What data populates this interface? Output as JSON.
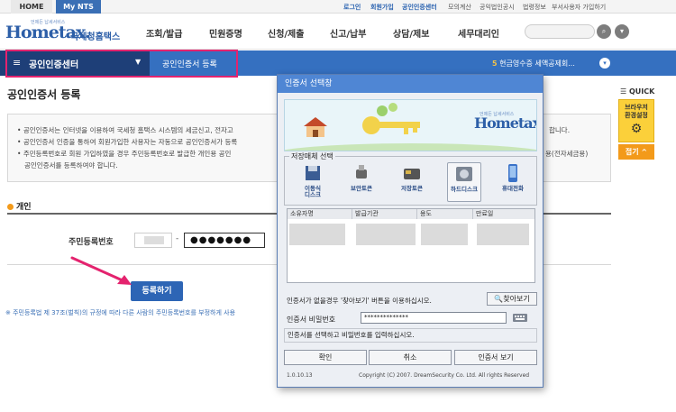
{
  "topbar": {
    "tab_home": "HOME",
    "tab_mynts": "My NTS",
    "links": [
      "로그인",
      "회원가입",
      "공인인증센터",
      "모의계산",
      "공익법인공시",
      "법령정보",
      "부서사용자 가입하기"
    ]
  },
  "header": {
    "logo_main": "Hometax.",
    "logo_sub": "국세청홈택스",
    "logo_tag": "언제든 납세서비스",
    "nav": [
      "조회/발급",
      "민원증명",
      "신청/제출",
      "신고/납부",
      "상담/제보",
      "세무대리인"
    ],
    "search_icon": "search-icon",
    "menu_icon": "chevron-down-icon"
  },
  "subnav": {
    "title": "공인인증센터",
    "breadcrumb": "공인인증서 등록",
    "notice_num": "5",
    "notice_text": "현금영수증 세액공제회..."
  },
  "page": {
    "title": "공인인증서 등록",
    "info": [
      "공인인증서는 인터넷을 이용하여 국세청 홈택스 시스템의 세금신고, 전자고",
      "공인인증서 인증을 통하여 회원가입한 사용자는 자동으로 공인인증서가 등록",
      "주민등록번호로 회원 가입하였을 경우 주민등록번호로 발급한 개인용 공인",
      "공인인증서를 등록하여야 합니다."
    ],
    "info_right": [
      "합니다.",
      "용(전자세금용)"
    ],
    "section": "개인",
    "jumin_label": "주민등록번호",
    "jumin_back": "●●●●●●●",
    "register_button": "등록하기",
    "footnote": "※ 주민등록법 제 37조(벌칙)의 규정에 따라 다른 사람의 주민등록번호를 부정하게 사용"
  },
  "quick": {
    "title": "QUICK",
    "card_text": "브라우저\n환경설정",
    "fold": "접기"
  },
  "dialog": {
    "title": "인증서 선택창",
    "banner_logo": "Hometax.",
    "banner_tag": "언제든 납세서비스",
    "storage_label": "저장매체 선택",
    "media": [
      {
        "label": "이동식\n디스크",
        "icon": "removable-disk-icon"
      },
      {
        "label": "보안토큰",
        "icon": "security-token-icon"
      },
      {
        "label": "저장토큰",
        "icon": "smart-card-icon"
      },
      {
        "label": "하드디스크",
        "icon": "hard-disk-icon"
      },
      {
        "label": "휴대전화",
        "icon": "mobile-phone-icon"
      }
    ],
    "table_headers": [
      "소유자명",
      "발급기관",
      "용도",
      "만료일"
    ],
    "hint": "인증서가 없을경우 '찾아보기' 버튼을 이용하십시오.",
    "find_button": "찾아보기",
    "pw_label": "인증서 비밀번호",
    "pw_value": "**************",
    "status": "인증서를 선택하고 비밀번호를 입력하십시오.",
    "ok_button": "확인",
    "cancel_button": "취소",
    "view_button": "인증서 보기",
    "version": "1.0.10.13",
    "copyright": "Copyright (C) 2007. DreamSecurity Co. Ltd. All rights Reserved"
  },
  "colors": {
    "brand_blue": "#3570c0",
    "dark_blue": "#1e3f78",
    "highlight_pink": "#e4236e",
    "quick_yellow": "#fbd03a",
    "quick_orange": "#f39a1a"
  }
}
